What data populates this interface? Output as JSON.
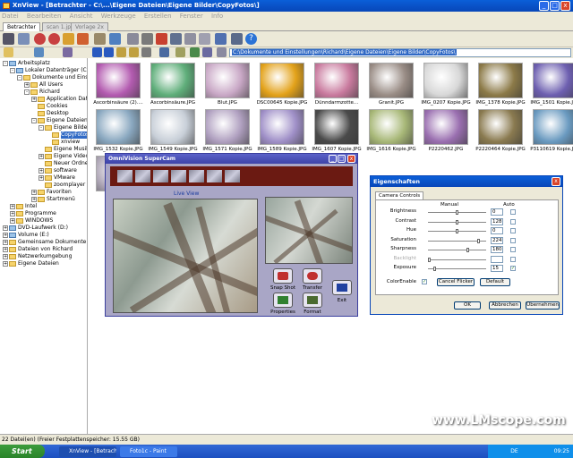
{
  "app": {
    "title": "XnView - [Betrachter - C:\\...\\Eigene Dateien\\Eigene Bilder\\CopyFotos\\]",
    "window_buttons": [
      "_",
      "□",
      "x"
    ]
  },
  "menu": [
    "Datei",
    "Bearbeiten",
    "Ansicht",
    "Werkzeuge",
    "Erstellen",
    "Fenster",
    "Info"
  ],
  "tabs": [
    "Betrachter",
    "scan 1.jpg",
    "Vorlage 2x"
  ],
  "address": "C:\\Dokumente und Einstellungen\\Richard\\Eigene Dateien\\Eigene Bilder\\CopyFotos\\",
  "tree": [
    {
      "label": "Arbeitsplatz",
      "toggle": "-"
    },
    {
      "label": "Lokaler Datenträger (C:)",
      "toggle": "-"
    },
    {
      "label": "Dokumente und Einstellungen",
      "toggle": "-"
    },
    {
      "label": "All Users",
      "toggle": "+"
    },
    {
      "label": "Richard",
      "toggle": "-"
    },
    {
      "label": "Application Data",
      "toggle": "+"
    },
    {
      "label": "Cookies",
      "toggle": ""
    },
    {
      "label": "Desktop",
      "toggle": ""
    },
    {
      "label": "Eigene Dateien",
      "toggle": "-"
    },
    {
      "label": "Eigene Bilder",
      "toggle": "-"
    },
    {
      "label": "CopyFotos",
      "toggle": ""
    },
    {
      "label": "xnview",
      "toggle": ""
    },
    {
      "label": "Eigene Musik",
      "toggle": ""
    },
    {
      "label": "Eigene Videos",
      "toggle": "+"
    },
    {
      "label": "Neuer Ordner",
      "toggle": ""
    },
    {
      "label": "software",
      "toggle": "+"
    },
    {
      "label": "VMware",
      "toggle": "+"
    },
    {
      "label": "zoomplayer",
      "toggle": ""
    },
    {
      "label": "Favoriten",
      "toggle": "+"
    },
    {
      "label": "Startmenü",
      "toggle": "+"
    },
    {
      "label": "Intel",
      "toggle": "+"
    },
    {
      "label": "Programme",
      "toggle": "+"
    },
    {
      "label": "WINDOWS",
      "toggle": "+"
    },
    {
      "label": "DVD-Laufwerk (D:)",
      "toggle": "+"
    },
    {
      "label": "Volume (E:)",
      "toggle": "+"
    },
    {
      "label": "Gemeinsame Dokumente",
      "toggle": "+"
    },
    {
      "label": "Dateien von Richard",
      "toggle": "+"
    },
    {
      "label": "Netzwerkumgebung",
      "toggle": "+"
    },
    {
      "label": "Eigene Dateien",
      "toggle": "+"
    }
  ],
  "thumbnails": [
    {
      "name": "Ascorbinsäure (2)....",
      "color": "#b35bb0"
    },
    {
      "name": "Ascorbinsäure.JPG",
      "color": "#5fae7a"
    },
    {
      "name": "Blut.JPG",
      "color": "#c9a8c6"
    },
    {
      "name": "DSC00645 Kopie.JPG",
      "color": "#e3a21a"
    },
    {
      "name": "Dünndarmzotte...",
      "color": "#c97a9e"
    },
    {
      "name": "Granit.JPG",
      "color": "#9a8d86"
    },
    {
      "name": "IMG_0207 Kopie.JPG",
      "color": "#d8d8d8"
    },
    {
      "name": "IMG_1378 Kopie.JPG",
      "color": "#8c7a48"
    },
    {
      "name": "IMG_1501 Kopie.JPG",
      "color": "#6d5fb0"
    },
    {
      "name": "IMG_1532 Kopie.JPG",
      "color": "#8aa8c0"
    },
    {
      "name": "IMG_1549 Kopie.JPG",
      "color": "#c8cfd8"
    },
    {
      "name": "IMG_1571 Kopie.JPG",
      "color": "#b0a0c0"
    },
    {
      "name": "IMG_1589 Kopie.JPG",
      "color": "#a090c8"
    },
    {
      "name": "IMG_1607 Kopie.JPG",
      "color": "#4a4a4a"
    },
    {
      "name": "IMG_1616 Kopie.JPG",
      "color": "#a8b878"
    },
    {
      "name": "P2220462.JPG",
      "color": "#9a6fb0"
    },
    {
      "name": "P2220464 Kopie.JPG",
      "color": "#8a7a50"
    },
    {
      "name": "P3110619 Kopie.JPG",
      "color": "#6a9ac0"
    },
    {
      "name": "P311...",
      "color": "#b0a8b8"
    },
    {
      "name": "",
      "color": "#9aa890"
    }
  ],
  "camera": {
    "title": "OmniVision SuperCam",
    "live_view": "Live  View",
    "buttons": [
      {
        "label": "Snap Shot",
        "color": "#c03030"
      },
      {
        "label": "Transfer",
        "color": "#c03030"
      },
      {
        "label": "Properties",
        "color": "#308030"
      },
      {
        "label": "Format",
        "color": "#4a6a30"
      },
      {
        "label": "Exit",
        "color": "#2040a0"
      }
    ]
  },
  "properties": {
    "title": "Eigenschaften",
    "tab": "Camera Controls",
    "col_manual": "Manual",
    "col_auto": "Auto",
    "rows": [
      {
        "label": "Brightness",
        "value": "0",
        "level": 0.5,
        "auto": false
      },
      {
        "label": "Contrast",
        "value": "128",
        "level": 0.5,
        "auto": false
      },
      {
        "label": "Hue",
        "value": "0",
        "level": 0.5,
        "auto": false
      },
      {
        "label": "Saturation",
        "value": "224",
        "level": 0.88,
        "auto": false
      },
      {
        "label": "Sharpness",
        "value": "180",
        "level": 0.7,
        "auto": false
      },
      {
        "label": "Backlight",
        "value": "",
        "level": 0.0,
        "auto": false
      },
      {
        "label": "Exposure",
        "value": "15",
        "level": 0.1,
        "auto": true
      }
    ],
    "color_enable": "ColorEnable",
    "btn_cancel_flicker": "Cancel Flicker",
    "btn_default": "Default",
    "btn_ok": "OK",
    "btn_cancel": "Abbrechen",
    "btn_apply": "Übernehmen"
  },
  "status": "22 Datei(en) (Freier Festplattenspeicher: 15.55 GB)",
  "taskbar": {
    "start": "Start",
    "tasks": [
      "XnView - [Betrachter ...",
      "Foto1c - Paint"
    ],
    "lang": "DE",
    "time": "09:25"
  },
  "watermark": "www.LMscope.com"
}
